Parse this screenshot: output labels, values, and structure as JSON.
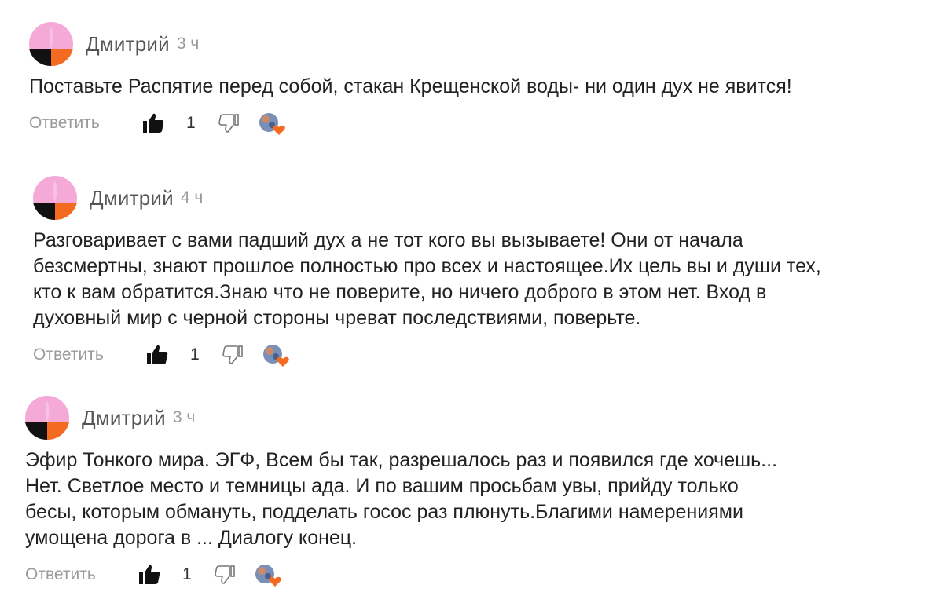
{
  "comments": [
    {
      "author": "Дмитрий",
      "time": "3 ч",
      "text": "Поставьте Распятие перед собой, стакан Крещенской воды- ни один дух не явится!",
      "reply_label": "Ответить",
      "likes": "1"
    },
    {
      "author": "Дмитрий",
      "time": "4 ч",
      "text": "Разговаривает с вами падший дух а не тот кого вы вызываете! Они от начала\nбезсмертны, знают прошлое полностью про всех и настоящее.Их цель вы и души тех,\nкто к вам обратится.Знаю что не поверите, но ничего доброго в этом нет. Вход в\nдуховный мир с черной стороны чреват последствиями, поверьте.",
      "reply_label": "Ответить",
      "likes": "1"
    },
    {
      "author": "Дмитрий",
      "time": "3 ч",
      "text": "Эфир Тонкого мира. ЭГФ, Всем бы так, разрешалось раз и появился где хочешь...\nНет. Светлое место и темницы ада. И по вашим просьбам увы, прийду только\nбесы, которым обмануть, подделать госос раз плюнуть.Благими намерениями\nумощена дорога в ... Диалогу конец.",
      "reply_label": "Ответить",
      "likes": "1"
    }
  ],
  "icons": {
    "avatar": "avatar-pink-black-orange",
    "like": "thumbs-up-icon",
    "dislike": "thumbs-down-icon",
    "reaction": "reaction-heart-icon"
  },
  "colors": {
    "avatar_pink": "#f5a9d6",
    "avatar_orange": "#f26b21",
    "avatar_black": "#111111",
    "heart": "#f26b21"
  }
}
